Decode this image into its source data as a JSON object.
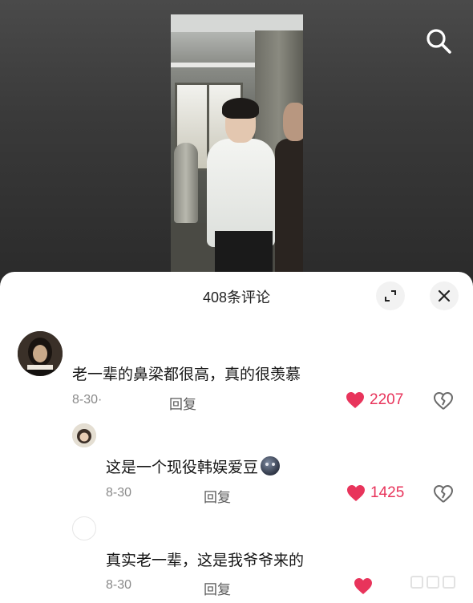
{
  "header": {
    "search_icon": "search-icon",
    "comment_count_title": "408条评论"
  },
  "panel": {
    "expand_icon": "expand-icon",
    "close_icon": "close-icon"
  },
  "comments": [
    {
      "text": "老一辈的鼻梁都很高，真的很羡慕",
      "date": "8-30·",
      "reply_label": "回复",
      "likes": "2207",
      "liked": true
    },
    {
      "text": "这是一个现役韩娱爱豆",
      "date": "8-30",
      "reply_label": "回复",
      "likes": "1425",
      "liked": true
    },
    {
      "text": "真实老一辈，这是我爷爷来的",
      "date": "8-30",
      "reply_label": "回复",
      "likes": "",
      "liked": true
    }
  ],
  "colors": {
    "like_red": "#e8345b",
    "panel_bg": "#ffffff",
    "video_bg": "#3a3a3a"
  }
}
